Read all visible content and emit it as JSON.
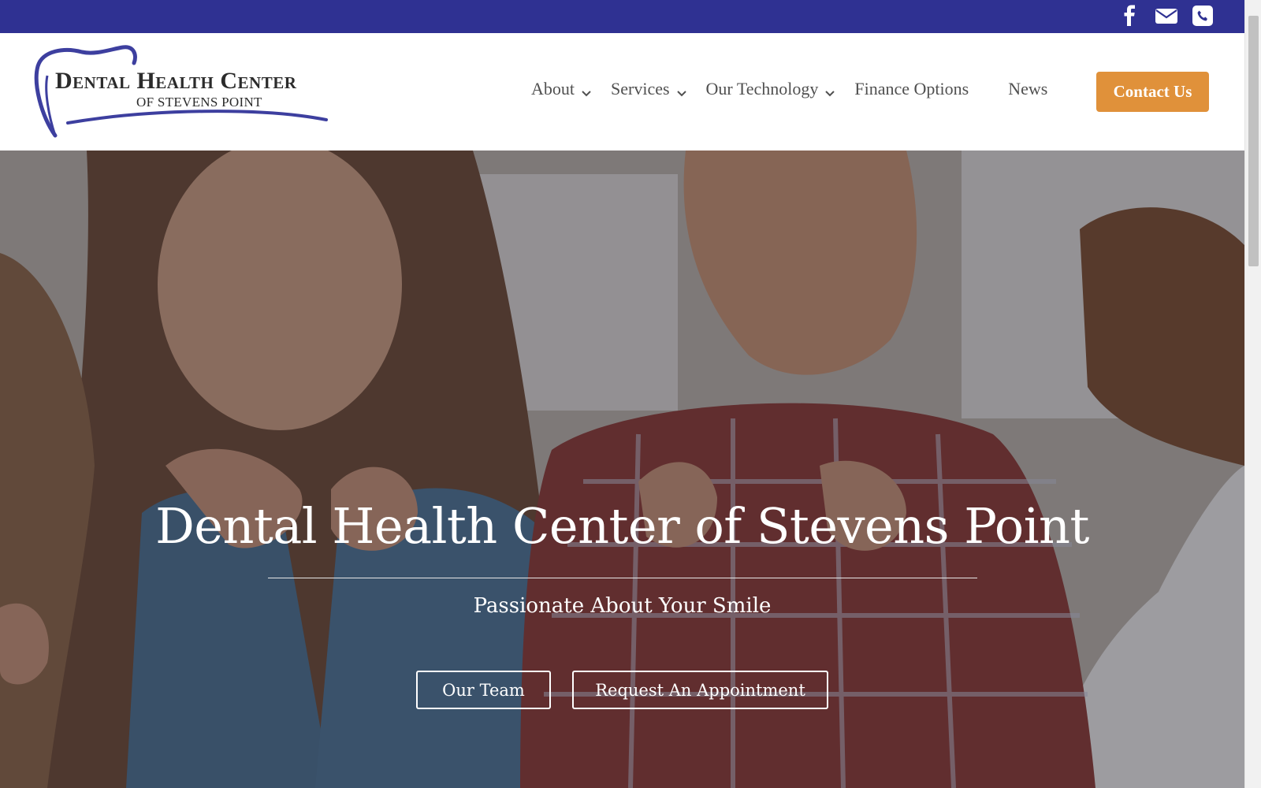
{
  "topbar": {
    "icons": [
      "facebook-icon",
      "mail-icon",
      "phone-icon"
    ],
    "color": "#2f3192"
  },
  "logo": {
    "line1": "Dental Health Center",
    "line2": "OF STEVENS POINT"
  },
  "nav": {
    "items": [
      {
        "label": "About",
        "has_dropdown": true
      },
      {
        "label": "Services",
        "has_dropdown": true
      },
      {
        "label": "Our Technology",
        "has_dropdown": true
      },
      {
        "label": "Finance Options",
        "has_dropdown": false
      },
      {
        "label": "News",
        "has_dropdown": false
      }
    ],
    "contact_label": "Contact Us",
    "contact_color": "#e0913a"
  },
  "hero": {
    "title": "Dental Health Center of Stevens Point",
    "subtitle": "Passionate About Your Smile",
    "buttons": [
      "Our Team",
      "Request An Appointment"
    ]
  }
}
